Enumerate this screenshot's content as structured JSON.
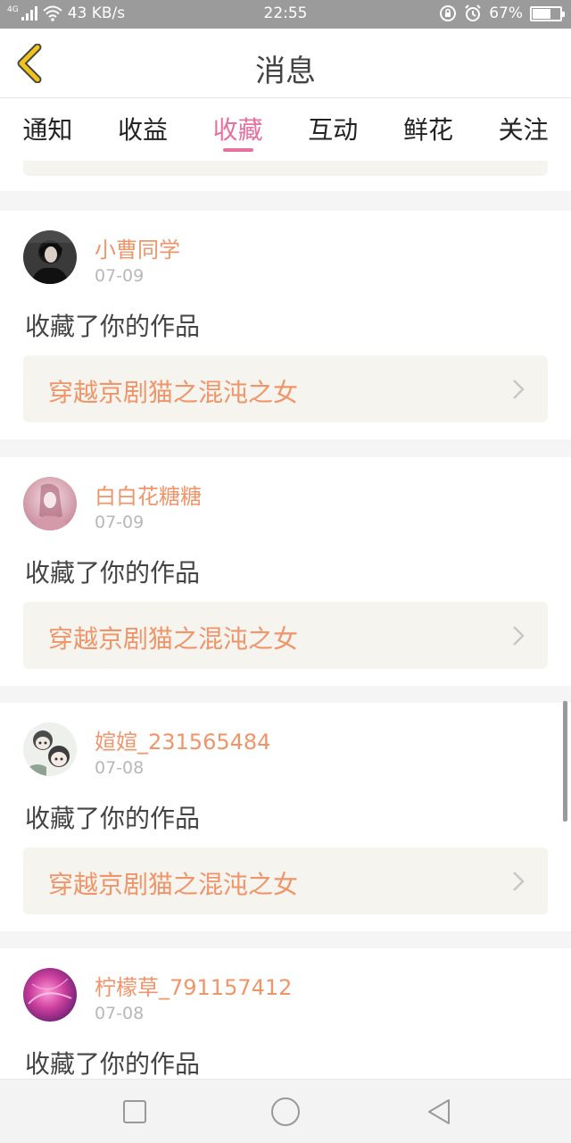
{
  "status_bar": {
    "network_type": "4G",
    "speed": "43 KB/s",
    "time": "22:55",
    "battery": "67%",
    "battery_level": 0.67
  },
  "header": {
    "title": "消息",
    "accent_color": "#f0c419"
  },
  "tabs": [
    {
      "label": "通知",
      "active": false
    },
    {
      "label": "收益",
      "active": false
    },
    {
      "label": "收藏",
      "active": true
    },
    {
      "label": "互动",
      "active": false
    },
    {
      "label": "鲜花",
      "active": false
    },
    {
      "label": "关注",
      "active": false
    }
  ],
  "colors": {
    "active_tab": "#e8709f",
    "username": "#f0956a",
    "work_title": "#f0956a",
    "work_box_bg": "#f5f4ee"
  },
  "messages": [
    {
      "username": "小曹同学",
      "date": "07-09",
      "action": "收藏了你的作品",
      "work_title": "穿越京剧猫之混沌之女"
    },
    {
      "username": "白白花糖糖",
      "date": "07-09",
      "action": "收藏了你的作品",
      "work_title": "穿越京剧猫之混沌之女"
    },
    {
      "username": "媗媗_231565484",
      "date": "07-08",
      "action": "收藏了你的作品",
      "work_title": "穿越京剧猫之混沌之女"
    },
    {
      "username": "柠檬草_791157412",
      "date": "07-08",
      "action": "收藏了你的作品",
      "work_title": ""
    }
  ],
  "nav_bar": {
    "icons": [
      "square-recent-icon",
      "circle-home-icon",
      "triangle-back-icon"
    ]
  }
}
